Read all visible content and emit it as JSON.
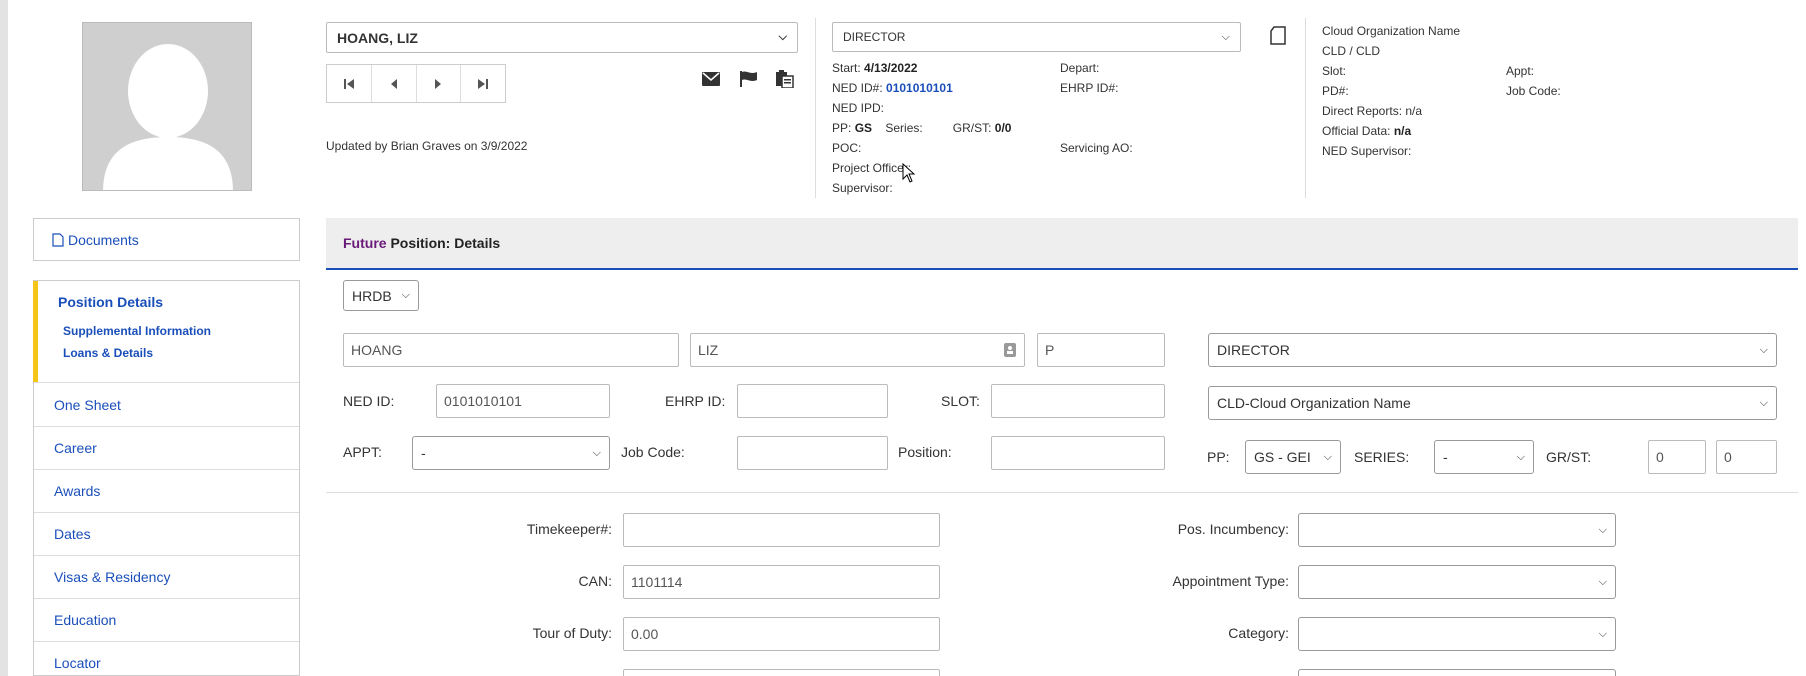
{
  "employee": {
    "name_select": "HOANG, LIZ",
    "updated_text": "Updated by Brian Graves on 3/9/2022"
  },
  "title_select": "DIRECTOR",
  "info": {
    "start_label": "Start:",
    "start_value": "4/13/2022",
    "depart_label": "Depart:",
    "ned_id_label": "NED ID#:",
    "ned_id_value": "0101010101",
    "ehrp_label": "EHRP ID#:",
    "ned_ipd_label": "NED IPD:",
    "pp_label": "PP:",
    "pp_value": "GS",
    "series_label": "Series:",
    "grst_label": "GR/ST:",
    "grst_value": "0/0",
    "poc_label": "POC:",
    "servicing_label": "Servicing AO:",
    "project_officer_label": "Project Officer:",
    "supervisor_label": "Supervisor:"
  },
  "org": {
    "name": "Cloud Organization Name",
    "code": "CLD  /  CLD",
    "slot_label": "Slot:",
    "appt_label": "Appt:",
    "pd_label": "PD#:",
    "job_code_label": "Job Code:",
    "direct_reports": "Direct Reports: n/a",
    "official_data_label": "Official Data:",
    "official_data_value": "n/a",
    "ned_supervisor_label": "NED Supervisor:"
  },
  "sidebar": {
    "documents": "Documents",
    "position_details": "Position Details",
    "supplemental": "Supplemental Information",
    "loans": "Loans & Details",
    "items": [
      "One Sheet",
      "Career",
      "Awards",
      "Dates",
      "Visas & Residency",
      "Education",
      "Locator"
    ]
  },
  "panel": {
    "title_future": "Future",
    "title_rest": "Position: Details",
    "source_select": "HRDB"
  },
  "form": {
    "last_name": "HOANG",
    "first_name": "LIZ",
    "middle": "P",
    "title": "DIRECTOR",
    "ned_id_label": "NED ID:",
    "ned_id": "0101010101",
    "ehrp_label": "EHRP ID:",
    "slot_label": "SLOT:",
    "org_select": "CLD-Cloud Organization Name",
    "appt_label": "APPT:",
    "appt_value": "-",
    "job_code_label": "Job Code:",
    "position_label": "Position:",
    "pp_label": "PP:",
    "pp_value": "GS - GEI",
    "series_label": "SERIES:",
    "series_value": "-",
    "grst_label": "GR/ST:",
    "gr_value": "0",
    "st_value": "0",
    "timekeeper_label": "Timekeeper#:",
    "can_label": "CAN:",
    "can_value": "1101114",
    "tour_label": "Tour of Duty:",
    "tour_value": "0.00",
    "incumbency_label": "Pos. Incumbency:",
    "appt_type_label": "Appointment Type:",
    "category_label": "Category:"
  },
  "colors": {
    "accent": "#1a4fba",
    "future": "#6a1b7a",
    "highlight": "#f5c518"
  }
}
